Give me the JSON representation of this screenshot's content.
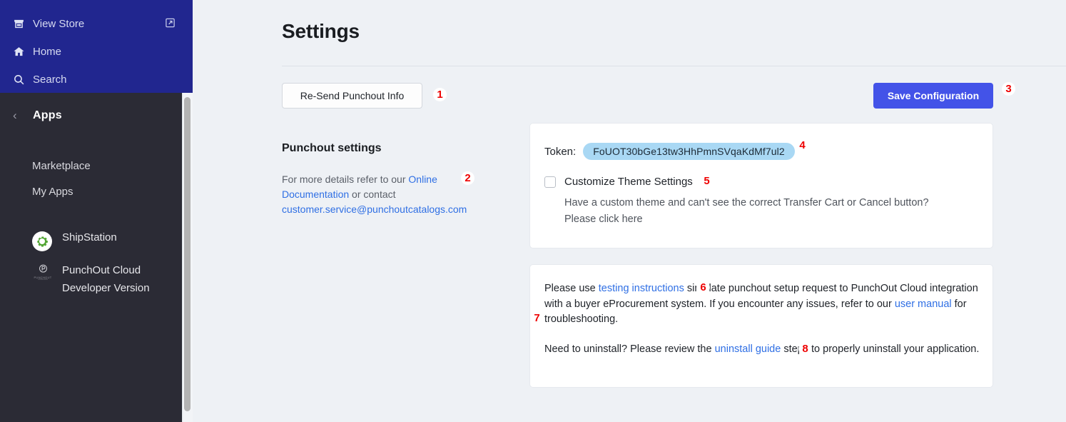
{
  "nav": {
    "items": [
      {
        "label": "View Store",
        "icon": "store-icon",
        "external": true
      },
      {
        "label": "Home",
        "icon": "home-icon",
        "external": false
      },
      {
        "label": "Search",
        "icon": "search-icon",
        "external": false
      }
    ]
  },
  "sidebar": {
    "header": {
      "back_icon": "chevron-left-icon",
      "title": "Apps"
    },
    "links": [
      {
        "label": "Marketplace"
      },
      {
        "label": "My Apps"
      }
    ],
    "apps": [
      {
        "label": "ShipStation",
        "icon": "shipstation-gear-icon"
      },
      {
        "label": "PunchOut Cloud Developer Version",
        "icon": "punchout-cloud-icon",
        "icon_word": "PUNCHOUT",
        "icon_sub": "CATALOGS"
      }
    ]
  },
  "main": {
    "title": "Settings",
    "resend_button": "Re-Send Punchout Info",
    "save_button": "Save Configuration",
    "punchout_settings": {
      "heading": "Punchout settings",
      "text_before": "For more details refer to our ",
      "link_docs": "Online Documentation",
      "text_middle": " or contact ",
      "link_email": "customer.service@punchoutcatalogs.com"
    },
    "token_card": {
      "token_label": "Token:",
      "token_value": "FoUOT30bGe13tw3HhPmnSVqaKdMf7ul2",
      "checkbox_label": "Customize Theme Settings",
      "checkbox_checked": false,
      "description_line1": "Have a custom theme and can't see the correct Transfer Cart or Cancel button?",
      "description_line2": "Please click here"
    },
    "info_card": {
      "p1_a": "Please use ",
      "p1_link1": "testing instructions",
      "p1_b": " simulate punchout setup request to PunchOut Cloud integration with a buyer eProcurement system. If you encounter any issues, refer to our ",
      "p1_link2": "user manual",
      "p1_c": " for troubleshooting.",
      "p2_a": "Need to uninstall? Please review the ",
      "p2_link": "uninstall guide",
      "p2_b": " steps to properly uninstall your application."
    }
  },
  "annotations": [
    {
      "number": "1"
    },
    {
      "number": "2"
    },
    {
      "number": "3"
    },
    {
      "number": "4"
    },
    {
      "number": "5"
    },
    {
      "number": "6"
    },
    {
      "number": "7"
    },
    {
      "number": "8"
    }
  ],
  "colors": {
    "navy": "#21268f",
    "sidebar_dark": "#2b2b35",
    "accent_blue": "#4353e8",
    "link_blue": "#2f6fe4",
    "token_chip": "#a9d8f4",
    "annotation_red": "#ee0000",
    "page_bg": "#eef1f5"
  }
}
